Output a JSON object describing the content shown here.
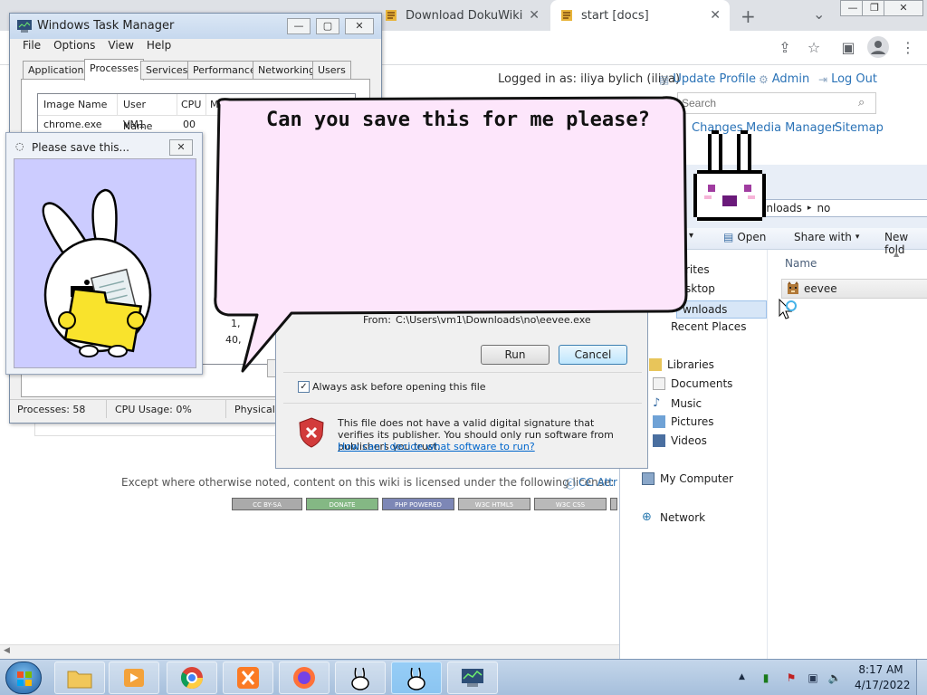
{
  "browser": {
    "tabs": [
      {
        "label": "Download DokuWiki",
        "close": "✕"
      },
      {
        "label": "start [docs]",
        "close": "✕"
      }
    ],
    "new_tab": "+",
    "tab_list": "⌄"
  },
  "wiki": {
    "logged_in": "Logged in as: iliya bylich (iliya)",
    "update_profile": "Update Profile",
    "admin": "Admin",
    "log_out": "Log Out",
    "search_placeholder": "Search",
    "recent_changes": "Changes",
    "media_manager": "Media Manager",
    "sitemap": "Sitemap",
    "license_text": "Except where otherwise noted, content on this wiki is licensed under the following license:",
    "license_link": "CC Attr",
    "badges": [
      "CC BY-SA",
      "DONATE",
      "PHP POWERED",
      "W3C HTML5",
      "W3C CSS"
    ]
  },
  "taskmgr": {
    "title": "Windows Task Manager",
    "menu": [
      "File",
      "Options",
      "View",
      "Help"
    ],
    "tabs": [
      "Applications",
      "Processes",
      "Services",
      "Performance",
      "Networking",
      "Users"
    ],
    "active_tab": "Processes",
    "columns": [
      "Image Name",
      "User Name",
      "CPU",
      "M"
    ],
    "rows": [
      {
        "image": "chrome.exe",
        "user": "VM1",
        "cpu": "00"
      }
    ],
    "fragments": [
      "1,",
      "40,"
    ],
    "status": {
      "processes": "Processes: 58",
      "cpu": "CPU Usage: 0%",
      "physical": "Physical"
    }
  },
  "popup": {
    "title": "Please save this...",
    "close": "✕"
  },
  "bubble": {
    "text": "Can you save this for me please?"
  },
  "security": {
    "from_label": "From:",
    "from_path": "C:\\Users\\vm1\\Downloads\\no\\eevee.exe",
    "run": "Run",
    "cancel": "Cancel",
    "checkbox_label": "Always ask before opening this file",
    "checkbox_checked": true,
    "warning": "This file does not have a valid digital signature that verifies its publisher.  You should only run software from publishers you trust.",
    "help_link": "How can I decide what software to run?"
  },
  "explorer": {
    "breadcrumb": [
      "Downloads",
      "no"
    ],
    "commands": {
      "open": "Open",
      "share": "Share with",
      "new_folder": "New fold"
    },
    "column_name": "Name",
    "file": "eevee",
    "nav": {
      "favorites_fragments": [
        "rites",
        "sktop",
        "wnloads"
      ],
      "recent": "Recent Places",
      "libraries": "Libraries",
      "documents": "Documents",
      "music": "Music",
      "pictures": "Pictures",
      "videos": "Videos",
      "computer": "My Computer",
      "network": "Network"
    }
  },
  "taskbar": {
    "time": "8:17 AM",
    "date": "4/17/2022",
    "pinned": [
      "start-orb",
      "explorer",
      "media-player",
      "chrome",
      "xampp",
      "firefox",
      "bunny-app",
      "bunny-app-2",
      "task-manager"
    ]
  },
  "colors": {
    "bubble_fill": "#fde6fb",
    "popup_bg": "#ccccff",
    "link": "#2b73b7",
    "folder_yellow": "#f9e32c"
  }
}
